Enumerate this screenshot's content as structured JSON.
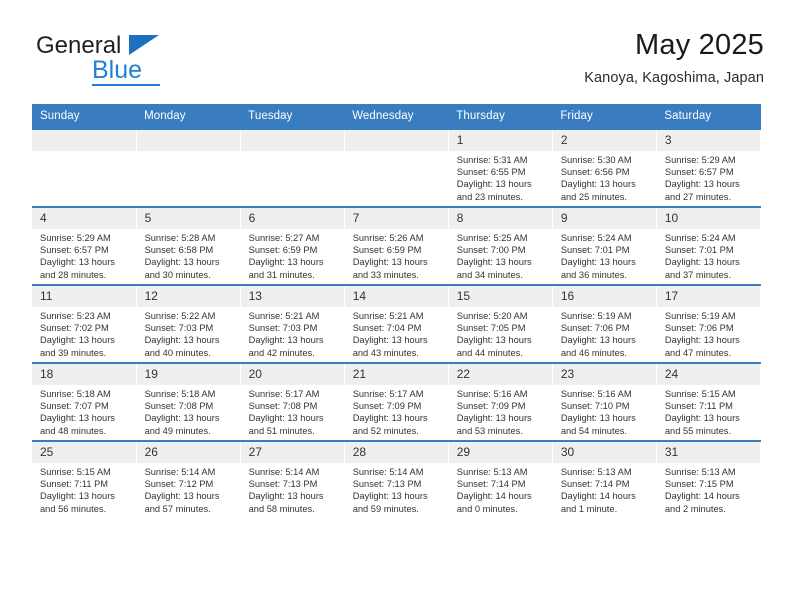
{
  "brand": {
    "name_top": "General",
    "name_bottom": "Blue",
    "accent_color": "#1f7fd4",
    "triangle_color": "#1f6fc0"
  },
  "header": {
    "title": "May 2025",
    "subtitle": "Kanoya, Kagoshima, Japan"
  },
  "calendar": {
    "header_bg": "#3a7cc0",
    "daynum_bg": "#efefef",
    "weekdays": [
      "Sunday",
      "Monday",
      "Tuesday",
      "Wednesday",
      "Thursday",
      "Friday",
      "Saturday"
    ],
    "weeks": [
      [
        {
          "day": "",
          "sunrise": "",
          "sunset": "",
          "daylight": "",
          "daylight2": ""
        },
        {
          "day": "",
          "sunrise": "",
          "sunset": "",
          "daylight": "",
          "daylight2": ""
        },
        {
          "day": "",
          "sunrise": "",
          "sunset": "",
          "daylight": "",
          "daylight2": ""
        },
        {
          "day": "",
          "sunrise": "",
          "sunset": "",
          "daylight": "",
          "daylight2": ""
        },
        {
          "day": "1",
          "sunrise": "Sunrise: 5:31 AM",
          "sunset": "Sunset: 6:55 PM",
          "daylight": "Daylight: 13 hours",
          "daylight2": "and 23 minutes."
        },
        {
          "day": "2",
          "sunrise": "Sunrise: 5:30 AM",
          "sunset": "Sunset: 6:56 PM",
          "daylight": "Daylight: 13 hours",
          "daylight2": "and 25 minutes."
        },
        {
          "day": "3",
          "sunrise": "Sunrise: 5:29 AM",
          "sunset": "Sunset: 6:57 PM",
          "daylight": "Daylight: 13 hours",
          "daylight2": "and 27 minutes."
        }
      ],
      [
        {
          "day": "4",
          "sunrise": "Sunrise: 5:29 AM",
          "sunset": "Sunset: 6:57 PM",
          "daylight": "Daylight: 13 hours",
          "daylight2": "and 28 minutes."
        },
        {
          "day": "5",
          "sunrise": "Sunrise: 5:28 AM",
          "sunset": "Sunset: 6:58 PM",
          "daylight": "Daylight: 13 hours",
          "daylight2": "and 30 minutes."
        },
        {
          "day": "6",
          "sunrise": "Sunrise: 5:27 AM",
          "sunset": "Sunset: 6:59 PM",
          "daylight": "Daylight: 13 hours",
          "daylight2": "and 31 minutes."
        },
        {
          "day": "7",
          "sunrise": "Sunrise: 5:26 AM",
          "sunset": "Sunset: 6:59 PM",
          "daylight": "Daylight: 13 hours",
          "daylight2": "and 33 minutes."
        },
        {
          "day": "8",
          "sunrise": "Sunrise: 5:25 AM",
          "sunset": "Sunset: 7:00 PM",
          "daylight": "Daylight: 13 hours",
          "daylight2": "and 34 minutes."
        },
        {
          "day": "9",
          "sunrise": "Sunrise: 5:24 AM",
          "sunset": "Sunset: 7:01 PM",
          "daylight": "Daylight: 13 hours",
          "daylight2": "and 36 minutes."
        },
        {
          "day": "10",
          "sunrise": "Sunrise: 5:24 AM",
          "sunset": "Sunset: 7:01 PM",
          "daylight": "Daylight: 13 hours",
          "daylight2": "and 37 minutes."
        }
      ],
      [
        {
          "day": "11",
          "sunrise": "Sunrise: 5:23 AM",
          "sunset": "Sunset: 7:02 PM",
          "daylight": "Daylight: 13 hours",
          "daylight2": "and 39 minutes."
        },
        {
          "day": "12",
          "sunrise": "Sunrise: 5:22 AM",
          "sunset": "Sunset: 7:03 PM",
          "daylight": "Daylight: 13 hours",
          "daylight2": "and 40 minutes."
        },
        {
          "day": "13",
          "sunrise": "Sunrise: 5:21 AM",
          "sunset": "Sunset: 7:03 PM",
          "daylight": "Daylight: 13 hours",
          "daylight2": "and 42 minutes."
        },
        {
          "day": "14",
          "sunrise": "Sunrise: 5:21 AM",
          "sunset": "Sunset: 7:04 PM",
          "daylight": "Daylight: 13 hours",
          "daylight2": "and 43 minutes."
        },
        {
          "day": "15",
          "sunrise": "Sunrise: 5:20 AM",
          "sunset": "Sunset: 7:05 PM",
          "daylight": "Daylight: 13 hours",
          "daylight2": "and 44 minutes."
        },
        {
          "day": "16",
          "sunrise": "Sunrise: 5:19 AM",
          "sunset": "Sunset: 7:06 PM",
          "daylight": "Daylight: 13 hours",
          "daylight2": "and 46 minutes."
        },
        {
          "day": "17",
          "sunrise": "Sunrise: 5:19 AM",
          "sunset": "Sunset: 7:06 PM",
          "daylight": "Daylight: 13 hours",
          "daylight2": "and 47 minutes."
        }
      ],
      [
        {
          "day": "18",
          "sunrise": "Sunrise: 5:18 AM",
          "sunset": "Sunset: 7:07 PM",
          "daylight": "Daylight: 13 hours",
          "daylight2": "and 48 minutes."
        },
        {
          "day": "19",
          "sunrise": "Sunrise: 5:18 AM",
          "sunset": "Sunset: 7:08 PM",
          "daylight": "Daylight: 13 hours",
          "daylight2": "and 49 minutes."
        },
        {
          "day": "20",
          "sunrise": "Sunrise: 5:17 AM",
          "sunset": "Sunset: 7:08 PM",
          "daylight": "Daylight: 13 hours",
          "daylight2": "and 51 minutes."
        },
        {
          "day": "21",
          "sunrise": "Sunrise: 5:17 AM",
          "sunset": "Sunset: 7:09 PM",
          "daylight": "Daylight: 13 hours",
          "daylight2": "and 52 minutes."
        },
        {
          "day": "22",
          "sunrise": "Sunrise: 5:16 AM",
          "sunset": "Sunset: 7:09 PM",
          "daylight": "Daylight: 13 hours",
          "daylight2": "and 53 minutes."
        },
        {
          "day": "23",
          "sunrise": "Sunrise: 5:16 AM",
          "sunset": "Sunset: 7:10 PM",
          "daylight": "Daylight: 13 hours",
          "daylight2": "and 54 minutes."
        },
        {
          "day": "24",
          "sunrise": "Sunrise: 5:15 AM",
          "sunset": "Sunset: 7:11 PM",
          "daylight": "Daylight: 13 hours",
          "daylight2": "and 55 minutes."
        }
      ],
      [
        {
          "day": "25",
          "sunrise": "Sunrise: 5:15 AM",
          "sunset": "Sunset: 7:11 PM",
          "daylight": "Daylight: 13 hours",
          "daylight2": "and 56 minutes."
        },
        {
          "day": "26",
          "sunrise": "Sunrise: 5:14 AM",
          "sunset": "Sunset: 7:12 PM",
          "daylight": "Daylight: 13 hours",
          "daylight2": "and 57 minutes."
        },
        {
          "day": "27",
          "sunrise": "Sunrise: 5:14 AM",
          "sunset": "Sunset: 7:13 PM",
          "daylight": "Daylight: 13 hours",
          "daylight2": "and 58 minutes."
        },
        {
          "day": "28",
          "sunrise": "Sunrise: 5:14 AM",
          "sunset": "Sunset: 7:13 PM",
          "daylight": "Daylight: 13 hours",
          "daylight2": "and 59 minutes."
        },
        {
          "day": "29",
          "sunrise": "Sunrise: 5:13 AM",
          "sunset": "Sunset: 7:14 PM",
          "daylight": "Daylight: 14 hours",
          "daylight2": "and 0 minutes."
        },
        {
          "day": "30",
          "sunrise": "Sunrise: 5:13 AM",
          "sunset": "Sunset: 7:14 PM",
          "daylight": "Daylight: 14 hours",
          "daylight2": "and 1 minute."
        },
        {
          "day": "31",
          "sunrise": "Sunrise: 5:13 AM",
          "sunset": "Sunset: 7:15 PM",
          "daylight": "Daylight: 14 hours",
          "daylight2": "and 2 minutes."
        }
      ]
    ]
  }
}
